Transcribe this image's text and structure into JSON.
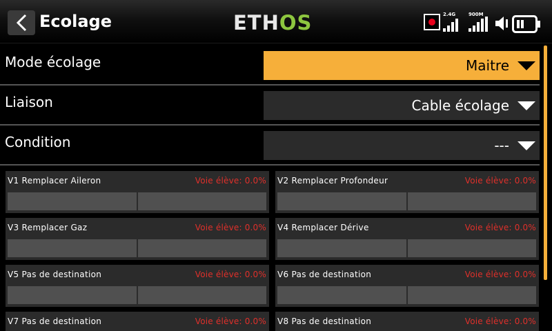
{
  "header": {
    "title": "Ecolage",
    "logo_left": "ETH",
    "logo_right": "OS",
    "band1_label": "2.4G",
    "band2_label": "900M"
  },
  "colors": {
    "accent": "#f6af3a",
    "logo_green": "#8dc63f",
    "status_red": "#e0302b",
    "record_red": "#e8001c"
  },
  "settings": [
    {
      "label": "Mode écolage",
      "value": "Maitre"
    },
    {
      "label": "Liaison",
      "value": "Cable écolage"
    },
    {
      "label": "Condition",
      "value": "---"
    }
  ],
  "channels": [
    {
      "name": "V1 Remplacer Aileron",
      "status": "Voie élève: 0.0%"
    },
    {
      "name": "V2 Remplacer Profondeur",
      "status": "Voie élève: 0.0%"
    },
    {
      "name": "V3 Remplacer Gaz",
      "status": "Voie élève: 0.0%"
    },
    {
      "name": "V4 Remplacer Dérive",
      "status": "Voie élève: 0.0%"
    },
    {
      "name": "V5 Pas de destination",
      "status": "Voie élève: 0.0%"
    },
    {
      "name": "V6 Pas de destination",
      "status": "Voie élève: 0.0%"
    },
    {
      "name": "V7 Pas de destination",
      "status": "Voie élève: 0.0%"
    },
    {
      "name": "V8 Pas de destination",
      "status": "Voie élève: 0.0%"
    }
  ]
}
